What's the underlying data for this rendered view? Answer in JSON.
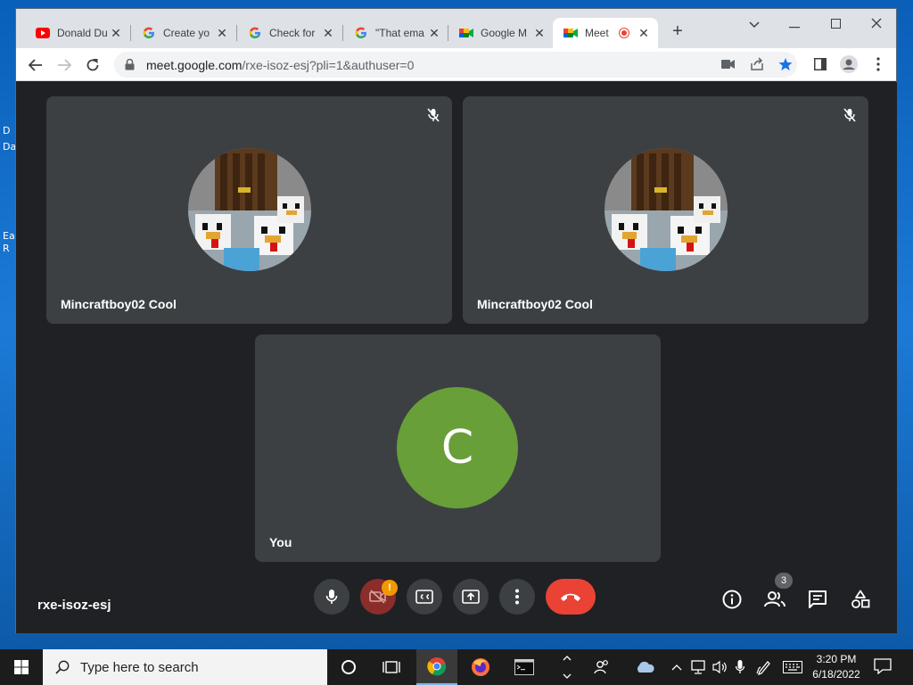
{
  "desktop": {
    "icon_labels": [
      "D",
      "Da",
      "Ea",
      "R"
    ]
  },
  "browser": {
    "tabs": [
      {
        "title": "Donald Du",
        "icon": "youtube-icon",
        "active": false
      },
      {
        "title": "Create yo",
        "icon": "google-icon",
        "active": false
      },
      {
        "title": "Check for",
        "icon": "google-icon",
        "active": false
      },
      {
        "title": "\"That ema",
        "icon": "google-icon",
        "active": false
      },
      {
        "title": "Google M",
        "icon": "google-meet-icon",
        "active": false
      },
      {
        "title": "Meet",
        "icon": "google-meet-icon",
        "active": true,
        "recording": true
      }
    ],
    "url_host": "meet.google.com",
    "url_path": "/rxe-isoz-esj?pli=1&authuser=0"
  },
  "meet": {
    "participants": [
      {
        "name": "Mincraftboy02 Cool",
        "muted": true
      },
      {
        "name": "Mincraftboy02 Cool",
        "muted": true
      },
      {
        "name": "You",
        "avatar_letter": "C",
        "avatar_color": "#689f38"
      }
    ],
    "meeting_code": "rxe-isoz-esj",
    "camera_warning": "!",
    "people_count": "3",
    "colors": {
      "tile": "#3c4043",
      "background": "#202124",
      "end_call": "#ea4335",
      "camera_off": "#8b2e2a",
      "warning": "#f29900"
    }
  },
  "taskbar": {
    "search_placeholder": "Type here to search",
    "time": "3:20 PM",
    "date": "6/18/2022"
  }
}
